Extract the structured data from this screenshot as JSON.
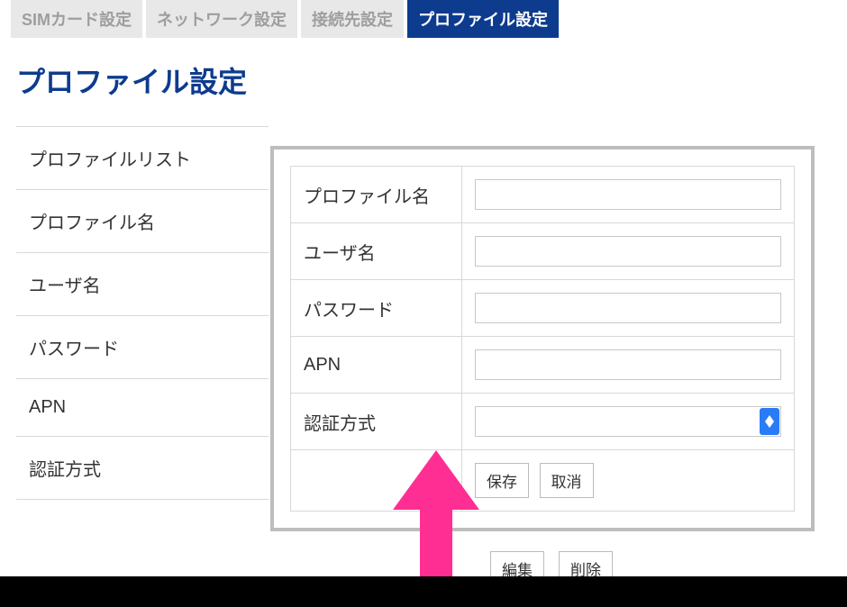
{
  "tabs": [
    {
      "label": "SIMカード設定",
      "active": false
    },
    {
      "label": "ネットワーク設定",
      "active": false
    },
    {
      "label": "接続先設定",
      "active": false
    },
    {
      "label": "プロファイル設定",
      "active": true
    }
  ],
  "page_title": "プロファイル設定",
  "bg_list": [
    "プロファイルリスト",
    "プロファイル名",
    "ユーザ名",
    "パスワード",
    "APN",
    "認証方式"
  ],
  "form": {
    "rows": [
      {
        "label": "プロファイル名",
        "type": "text",
        "value": ""
      },
      {
        "label": "ユーザ名",
        "type": "text",
        "value": ""
      },
      {
        "label": "パスワード",
        "type": "text",
        "value": ""
      },
      {
        "label": "APN",
        "type": "text",
        "value": ""
      },
      {
        "label": "認証方式",
        "type": "select",
        "value": ""
      }
    ],
    "save_label": "保存",
    "cancel_label": "取消"
  },
  "hidden_buttons": [
    "編集",
    "削除"
  ],
  "colors": {
    "accent": "#0d3b8e",
    "tab_inactive_bg": "#e8e8e8",
    "tab_inactive_fg": "#9e9e9e",
    "panel_border": "#bdbdbd",
    "select_arrow_bg": "#2a7bf6",
    "arrow_annotation": "#ff2e93"
  }
}
